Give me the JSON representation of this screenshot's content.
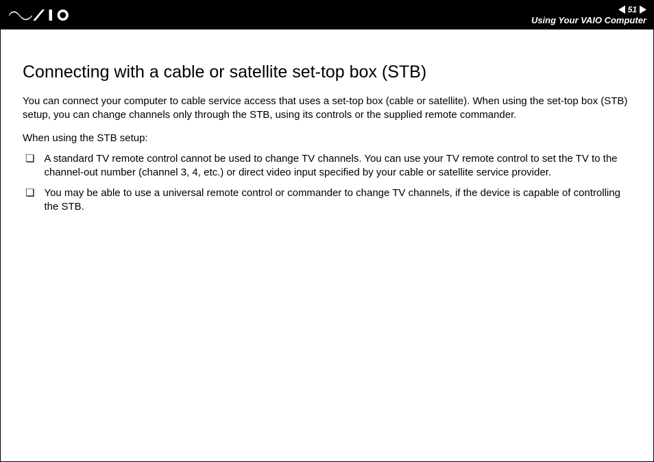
{
  "header": {
    "page_number": "51",
    "breadcrumb": "Using Your VAIO Computer"
  },
  "content": {
    "title": "Connecting with a cable or satellite set-top box (STB)",
    "intro": "You can connect your computer to cable service access that uses a set-top box (cable or satellite). When using the set-top box (STB) setup, you can change channels only through the STB, using its controls or the supplied remote commander.",
    "lead": "When using the STB setup:",
    "bullets": [
      "A standard TV remote control cannot be used to change TV channels. You can use your TV remote control to set the TV to the channel-out number (channel 3, 4, etc.) or direct video input specified by your cable or satellite service provider.",
      "You may be able to use a universal remote control or commander to change TV channels, if the device is capable of controlling the STB."
    ],
    "bullet_glyph": "❏"
  }
}
